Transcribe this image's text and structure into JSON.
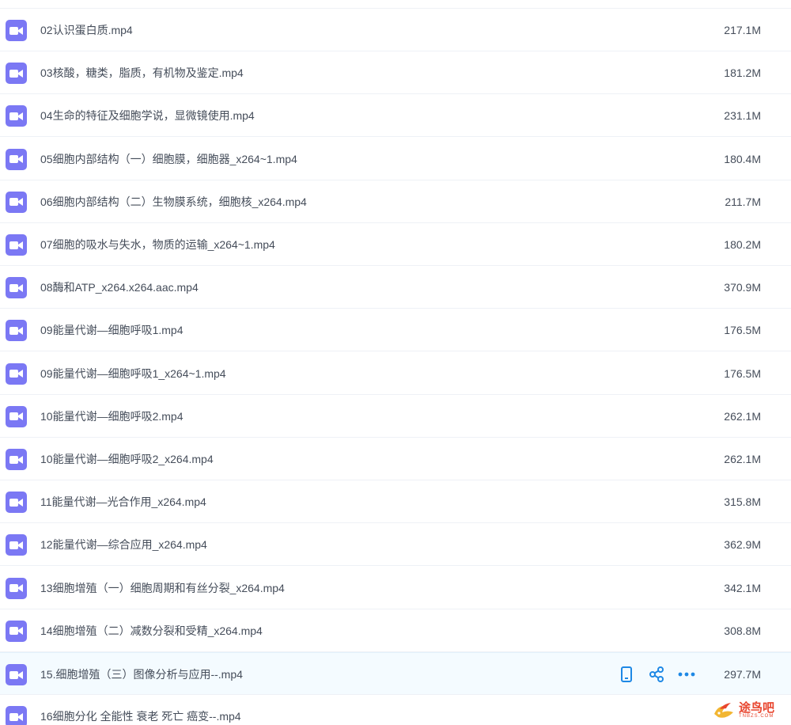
{
  "files": [
    {
      "name": "02认识蛋白质.mp4",
      "size": "217.1M"
    },
    {
      "name": "03核酸，糖类，脂质，有机物及鉴定.mp4",
      "size": "181.2M"
    },
    {
      "name": "04生命的特征及细胞学说，显微镜使用.mp4",
      "size": "231.1M"
    },
    {
      "name": "05细胞内部结构（一）细胞膜，细胞器_x264~1.mp4",
      "size": "180.4M"
    },
    {
      "name": "06细胞内部结构（二）生物膜系统，细胞核_x264.mp4",
      "size": "211.7M"
    },
    {
      "name": "07细胞的吸水与失水，物质的运输_x264~1.mp4",
      "size": "180.2M"
    },
    {
      "name": "08酶和ATP_x264.x264.aac.mp4",
      "size": "370.9M"
    },
    {
      "name": "09能量代谢—细胞呼吸1.mp4",
      "size": "176.5M"
    },
    {
      "name": "09能量代谢—细胞呼吸1_x264~1.mp4",
      "size": "176.5M"
    },
    {
      "name": "10能量代谢—细胞呼吸2.mp4",
      "size": "262.1M"
    },
    {
      "name": "10能量代谢—细胞呼吸2_x264.mp4",
      "size": "262.1M"
    },
    {
      "name": "11能量代谢—光合作用_x264.mp4",
      "size": "315.8M"
    },
    {
      "name": "12能量代谢—综合应用_x264.mp4",
      "size": "362.9M"
    },
    {
      "name": "13细胞增殖（一）细胞周期和有丝分裂_x264.mp4",
      "size": "342.1M"
    },
    {
      "name": "14细胞增殖（二）减数分裂和受精_x264.mp4",
      "size": "308.8M"
    },
    {
      "name": "15.细胞增殖（三）图像分析与应用--.mp4",
      "size": "297.7M",
      "hovered": true
    },
    {
      "name": "16细胞分化 全能性 衰老 死亡 癌变--.mp4",
      "size": ""
    }
  ],
  "icons": {
    "file": "video-file-icon",
    "actions": [
      "phone-icon",
      "share-icon",
      "more-icon"
    ]
  },
  "colors": {
    "video_icon": "#7b78f4",
    "action": "#1e88e5",
    "hover_row": "#f4fbff",
    "watermark": "#e8462f"
  },
  "watermark": {
    "text": "途鸟吧",
    "sub": "TNBZS.COM"
  }
}
